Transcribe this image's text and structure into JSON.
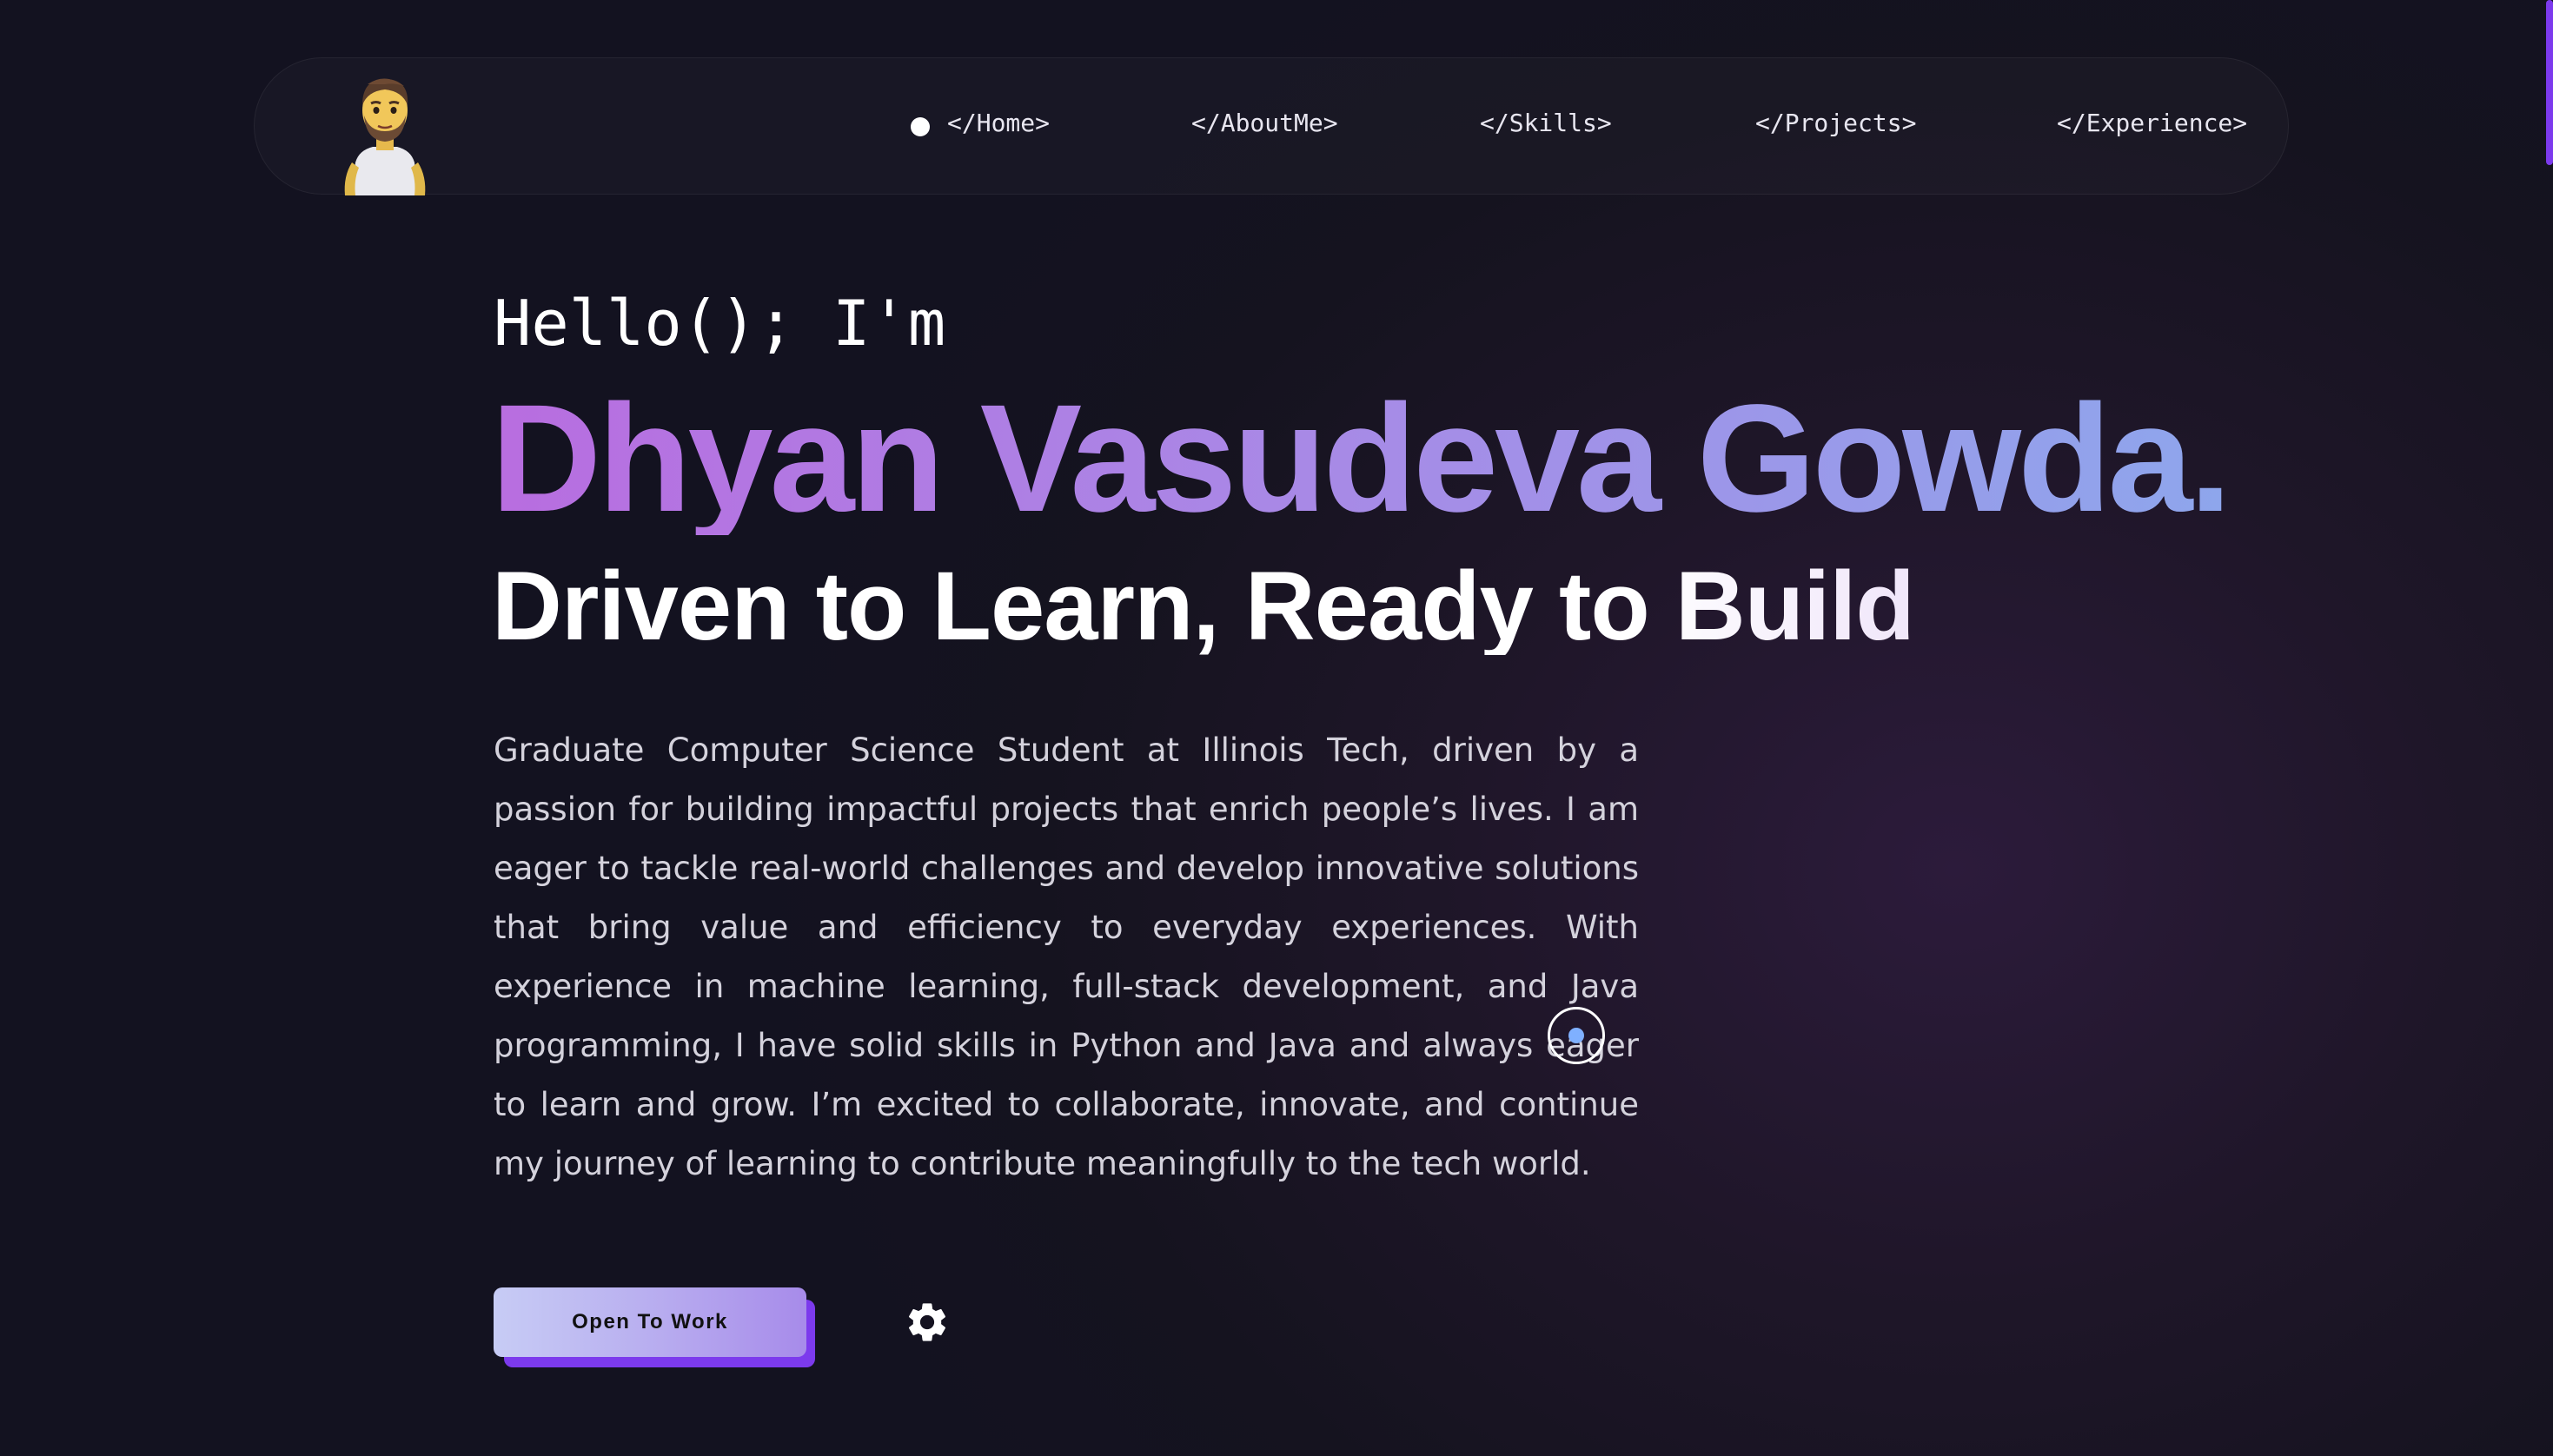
{
  "nav": {
    "items": [
      {
        "label": "</Home>"
      },
      {
        "label": "</AboutMe>"
      },
      {
        "label": "</Skills>"
      },
      {
        "label": "</Projects>"
      },
      {
        "label": "</Experience>"
      }
    ],
    "active_index": 0,
    "avatar_icon": "memoji-avatar-icon"
  },
  "hero": {
    "greeting": "Hello(); I'm",
    "name": "Dhyan Vasudeva Gowda.",
    "tagline": "Driven to Learn, Ready to Build",
    "bio": "Graduate Computer Science Student at Illinois Tech, driven by a passion for building impactful projects that enrich people’s lives. I am eager to tackle real-world challenges and develop innovative solutions that bring value and efficiency to everyday experiences. With experience in machine learning, full-stack development, and Java programming, I have solid skills in Python and Java and always eager to learn and grow. I’m excited to collaborate, innovate, and continue my journey of learning to contribute meaningfully to the tech world.",
    "cta_label": "Open To Work",
    "settings_icon": "gear-icon"
  },
  "colors": {
    "accent": "#7c3aed",
    "name_gradient_start": "#b86de0",
    "name_gradient_end": "#8ea6ec",
    "background": "#15131f"
  }
}
